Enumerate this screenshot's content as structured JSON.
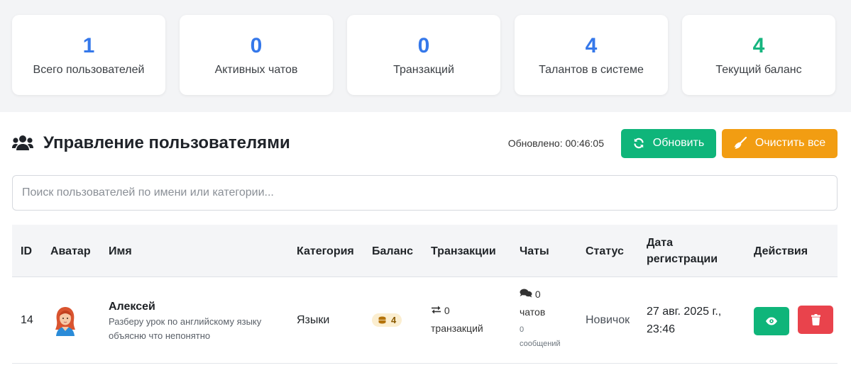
{
  "stats": [
    {
      "value": "1",
      "label": "Всего пользователей",
      "color": "#3578ea"
    },
    {
      "value": "0",
      "label": "Активных чатов",
      "color": "#3578ea"
    },
    {
      "value": "0",
      "label": "Транзакций",
      "color": "#3578ea"
    },
    {
      "value": "4",
      "label": "Талантов в системе",
      "color": "#3578ea"
    },
    {
      "value": "4",
      "label": "Текущий баланс",
      "color": "#16b57f"
    }
  ],
  "header": {
    "title": "Управление пользователями",
    "updated": "Обновлено: 00:46:05",
    "refresh_label": "Обновить",
    "clear_label": "Очистить все"
  },
  "search": {
    "placeholder": "Поиск пользователей по имени или категории..."
  },
  "table": {
    "columns": {
      "id": "ID",
      "avatar": "Аватар",
      "name": "Имя",
      "category": "Категория",
      "balance": "Баланс",
      "transactions": "Транзакции",
      "chats": "Чаты",
      "status": "Статус",
      "date_line1": "Дата",
      "date_line2": "регистрации",
      "actions": "Действия"
    },
    "rows": [
      {
        "id": "14",
        "name": "Алексей",
        "description": "Разберу урок по английскому языку объясню что непонятно",
        "category": "Языки",
        "balance": "4",
        "transactions_count": "0",
        "transactions_label": "транзакций",
        "chats_count": "0",
        "chats_label": "чатов",
        "messages_count": "0",
        "messages_label": "сообщений",
        "status": "Новичок",
        "date_line1": "27 авг. 2025 г.,",
        "date_line2": "23:46"
      }
    ]
  },
  "colors": {
    "accent_blue": "#3578ea",
    "success": "#0fb57a",
    "warning": "#f29d12",
    "danger": "#e9434c"
  },
  "icons": [
    "users-icon",
    "sync-icon",
    "broom-icon",
    "coins-icon",
    "exchange-icon",
    "comments-icon",
    "eye-icon",
    "trash-icon"
  ]
}
